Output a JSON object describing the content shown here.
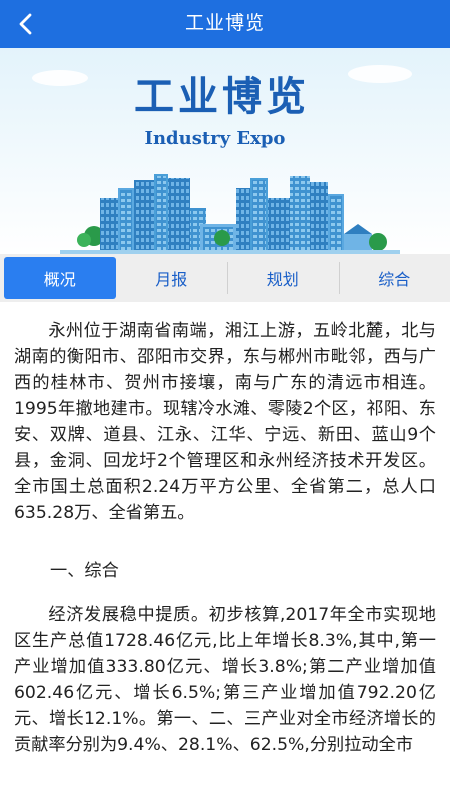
{
  "header": {
    "title": "工业博览",
    "back_icon": "chevron-left-icon"
  },
  "banner": {
    "title_cn": "工业博览",
    "title_en": "Industry Expo",
    "colors": {
      "sky_top": "#e3f3fb",
      "sky_bottom": "#ffffff",
      "title": "#1b5fb4",
      "buildings": "#4a9fd8"
    }
  },
  "tabs": [
    {
      "label": "概况",
      "active": true
    },
    {
      "label": "月报",
      "active": false
    },
    {
      "label": "规划",
      "active": false
    },
    {
      "label": "综合",
      "active": false
    }
  ],
  "content": {
    "intro": "永州位于湖南省南端，湘江上游，五岭北麓，北与湖南的衡阳市、邵阳市交界，东与郴州市毗邻，西与广西的桂林市、贺州市接壤，南与广东的清远市相连。1995年撤地建市。现辖冷水滩、零陵2个区，祁阳、东安、双牌、道县、江永、江华、宁远、新田、蓝山9个县，金洞、回龙圩2个管理区和永州经济技术开发区。全市国土总面积2.24万平方公里、全省第二，总人口635.28万、全省第五。",
    "section1_title": "一、综合",
    "section1_text": "经济发展稳中提质。初步核算,2017年全市实现地区生产总值1728.46亿元,比上年增长8.3%,其中,第一产业增加值333.80亿元、增长3.8%;第二产业增加值602.46亿元、增长6.5%;第三产业增加值792.20亿元、增长12.1%。第一、二、三产业对全市经济增长的贡献率分别为9.4%、28.1%、62.5%,分别拉动全市"
  },
  "theme": {
    "primary": "#1e6fe0",
    "tab_active": "#2a7ef0",
    "tab_bar": "#eeeeee",
    "tab_text": "#1a5fc8"
  }
}
